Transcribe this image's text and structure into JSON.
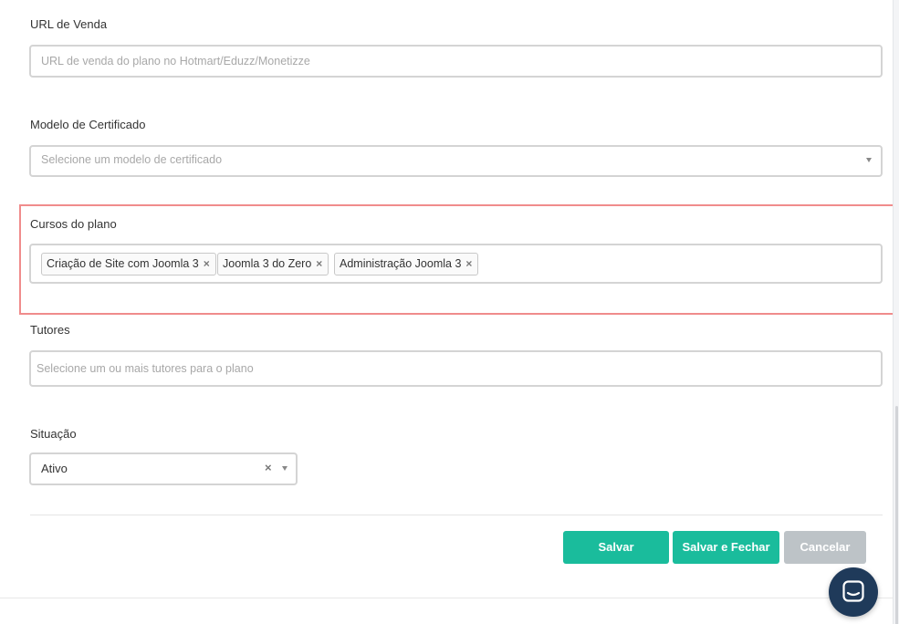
{
  "fields": {
    "url_venda": {
      "label": "URL de Venda",
      "placeholder": "URL de venda do plano no Hotmart/Eduzz/Monetizze"
    },
    "modelo_certificado": {
      "label": "Modelo de Certificado",
      "placeholder": "Selecione um modelo de certificado"
    },
    "cursos_plano": {
      "label": "Cursos do plano",
      "tags": [
        "Criação de Site com Joomla 3",
        "Joomla 3 do Zero",
        "Administração Joomla 3"
      ]
    },
    "tutores": {
      "label": "Tutores",
      "placeholder": "Selecione um ou mais tutores para o plano"
    },
    "situacao": {
      "label": "Situação",
      "value": "Ativo"
    }
  },
  "actions": {
    "save_label": "Salvar",
    "save_close_label": "Salvar e Fechar",
    "cancel_label": "Cancelar"
  },
  "icons": {
    "remove": "×",
    "dropdown": "chevron-down-icon",
    "chat": "chat-icon"
  },
  "colors": {
    "primary": "#1abc9c",
    "disabled": "#bdc3c7",
    "highlight": "#f08c8c",
    "chat_bubble": "#1f3a5a"
  }
}
